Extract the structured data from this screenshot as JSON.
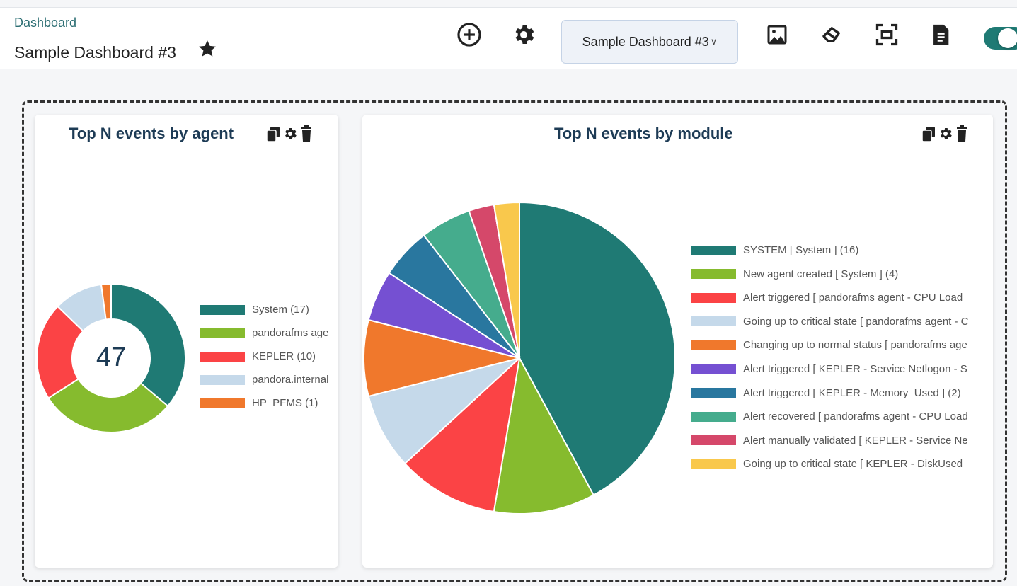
{
  "header": {
    "breadcrumb": "Dashboard",
    "title": "Sample Dashboard #3",
    "dashboard_select": {
      "value": "Sample Dashboard #3"
    },
    "icons": [
      "add-circle-icon",
      "gear-icon",
      "image-icon",
      "eraser-icon",
      "fullscreen-icon",
      "document-icon",
      "toggle-switch"
    ]
  },
  "colors": {
    "accent": "#1f7a74",
    "title": "#1d3b55"
  },
  "widgets": [
    {
      "title": "Top N events by agent",
      "chart_data": {
        "type": "pie",
        "subtype": "doughnut",
        "center_label": "47",
        "series": [
          {
            "label": "System (17)",
            "value": 17,
            "color": "#1f7a74"
          },
          {
            "label": "pandorafms age",
            "value": 14,
            "color": "#86bb2e"
          },
          {
            "label": "KEPLER (10)",
            "value": 10,
            "color": "#fb4345"
          },
          {
            "label": "pandora.internal",
            "value": 5,
            "color": "#c5d9ea"
          },
          {
            "label": "HP_PFMS (1)",
            "value": 1,
            "color": "#f0782c"
          }
        ]
      }
    },
    {
      "title": "Top N events by module",
      "chart_data": {
        "type": "pie",
        "series": [
          {
            "label": "SYSTEM [ System ] (16)",
            "value": 16,
            "color": "#1f7a74"
          },
          {
            "label": "New agent created [ System ] (4)",
            "value": 4,
            "color": "#86bb2e"
          },
          {
            "label": "Alert triggered [ pandorafms agent - CPU Load",
            "value": 4,
            "color": "#fb4345"
          },
          {
            "label": "Going up to critical state [ pandorafms agent - C",
            "value": 3,
            "color": "#c5d9ea"
          },
          {
            "label": "Changing up to normal status [ pandorafms age",
            "value": 3,
            "color": "#f0782c"
          },
          {
            "label": "Alert triggered [ KEPLER - Service Netlogon - S",
            "value": 2,
            "color": "#7550d2"
          },
          {
            "label": "Alert triggered [ KEPLER - Memory_Used ] (2)",
            "value": 2,
            "color": "#29779f"
          },
          {
            "label": "Alert recovered [ pandorafms agent - CPU Load",
            "value": 2,
            "color": "#45ac8d"
          },
          {
            "label": "Alert manually validated [ KEPLER - Service Ne",
            "value": 1,
            "color": "#d5486a"
          },
          {
            "label": "Going up to critical state [ KEPLER - DiskUsed_",
            "value": 1,
            "color": "#f9c84c"
          }
        ]
      }
    }
  ]
}
